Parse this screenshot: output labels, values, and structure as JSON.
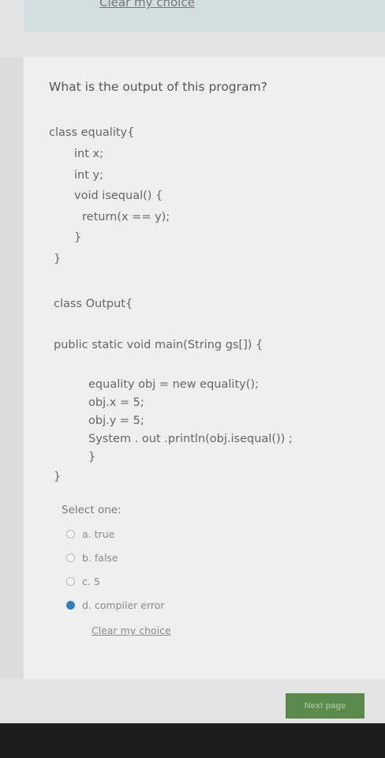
{
  "top": {
    "clear_label": "Clear my choice"
  },
  "question": {
    "text": "What is the output of this program?",
    "code_lines": [
      "class equality{",
      "int x;",
      "int y;",
      "void isequal() {",
      "return(x == y);",
      "}",
      "}",
      "class Output{",
      "public static void main(String gs[]) {",
      "equality obj = new equality();",
      "obj.x = 5;",
      "obj.y = 5;",
      "System . out .println(obj.isequal()) ;",
      "}",
      "}"
    ]
  },
  "answer": {
    "select_label": "Select one:",
    "options": [
      {
        "label": "a. true",
        "selected": false
      },
      {
        "label": "b. false",
        "selected": false
      },
      {
        "label": "c. 5",
        "selected": false
      },
      {
        "label": "d. compiler error",
        "selected": true
      }
    ],
    "clear_label": "Clear my choice"
  },
  "footer": {
    "next_label": "Next page"
  }
}
